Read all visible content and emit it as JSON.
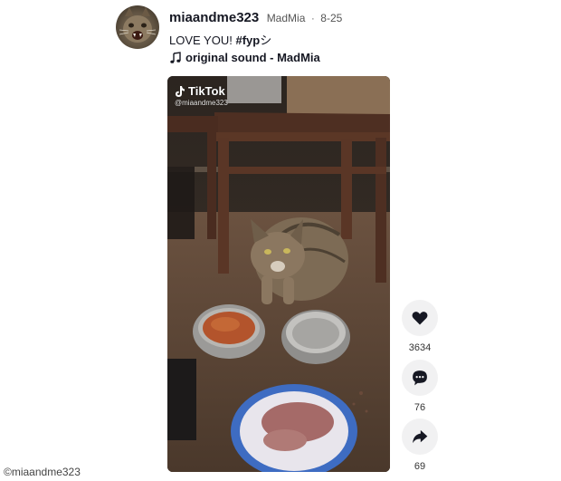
{
  "post": {
    "username": "miaandme323",
    "nickname": "MadMia",
    "separator": "·",
    "date": "8-25",
    "caption_text": "LOVE YOU! ",
    "caption_hashtag": "#fyp",
    "caption_emoji": "シ",
    "sound": "original sound - MadMia"
  },
  "video": {
    "watermark_brand": "TikTok",
    "watermark_handle": "@miaandme323"
  },
  "actions": {
    "like_count": "3634",
    "comment_count": "76",
    "share_count": "69"
  },
  "credit": "©miaandme323",
  "icons": [
    "avatar-cat",
    "music-note-icon",
    "tiktok-logo-icon",
    "heart-icon",
    "comment-icon",
    "share-icon"
  ]
}
